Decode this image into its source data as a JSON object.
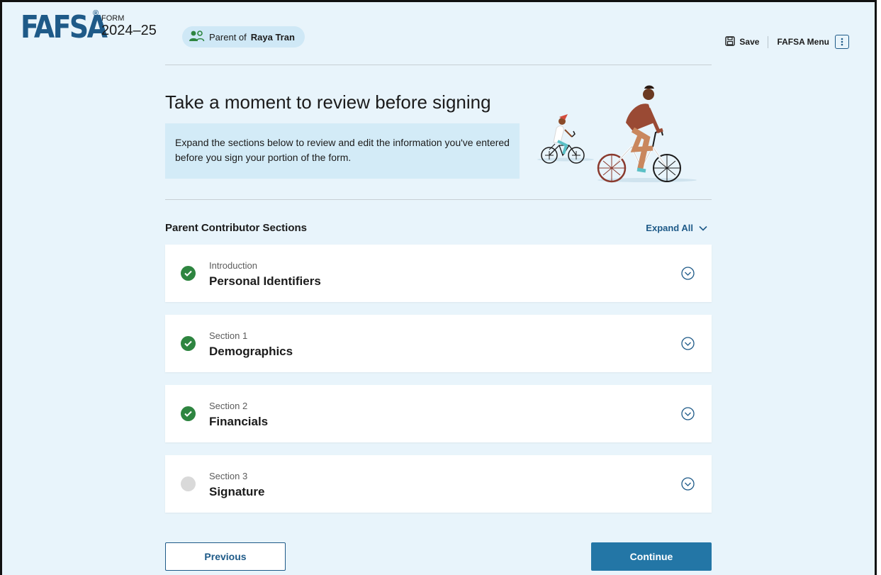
{
  "header": {
    "logo": "FAFSA",
    "registered_mark": "®",
    "form_label": "FORM",
    "form_year": "2024–25",
    "role_prefix": "Parent of",
    "student_name": "Raya Tran",
    "save_label": "Save",
    "menu_label": "FAFSA Menu"
  },
  "intro": {
    "title": "Take a moment to review before signing",
    "info_text": "Expand the sections below to review and edit the information you've entered before you sign your portion of the form."
  },
  "sections": {
    "heading": "Parent Contributor Sections",
    "expand_all": "Expand All",
    "items": [
      {
        "sub": "Introduction",
        "name": "Personal Identifiers",
        "status": "complete"
      },
      {
        "sub": "Section 1",
        "name": "Demographics",
        "status": "complete"
      },
      {
        "sub": "Section 2",
        "name": "Financials",
        "status": "complete"
      },
      {
        "sub": "Section 3",
        "name": "Signature",
        "status": "incomplete"
      }
    ]
  },
  "footer": {
    "previous_label": "Previous",
    "continue_label": "Continue"
  },
  "colors": {
    "brand": "#1e5a88",
    "page_bg": "#e8f4fb",
    "complete": "#2e8540",
    "primary_button": "#2376a6"
  }
}
